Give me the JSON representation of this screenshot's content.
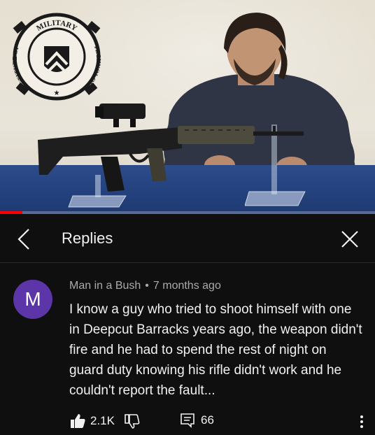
{
  "video": {
    "logo_top_text": "MILITARY",
    "logo_left_text": "INSTITUTE OF",
    "logo_right_text": "TECHNOLOGY",
    "progress_fraction": 0.06,
    "progress_color": "#ff0000"
  },
  "header": {
    "title": "Replies",
    "back_icon": "chevron-left-icon",
    "close_icon": "close-icon"
  },
  "comment": {
    "avatar_letter": "M",
    "avatar_color": "#5c35a8",
    "author": "Man in a Bush",
    "separator": "•",
    "time": "7 months ago",
    "text": "I know a guy who tried to shoot himself with one in Deepcut Barracks years ago, the weapon didn't fire and he had to spend the rest of night on guard duty knowing his rifle didn't work and he couldn't report the fault...",
    "likes": "2.1K",
    "replies": "66"
  }
}
